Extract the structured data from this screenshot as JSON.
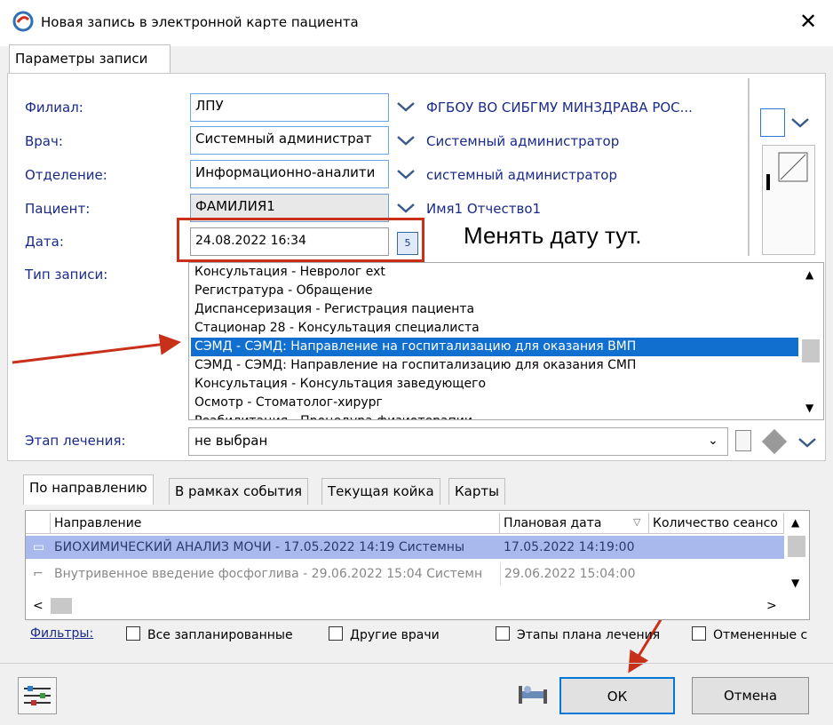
{
  "window": {
    "title": "Новая запись в электронной карте пациента",
    "close_glyph": "✕"
  },
  "tabs_top": {
    "params": "Параметры записи"
  },
  "form": {
    "branch": {
      "label": "Филиал:",
      "value": "ЛПУ",
      "link": "ФГБОУ ВО СИБГМУ МИНЗДРАВА РОС..."
    },
    "doctor": {
      "label": "Врач:",
      "value": "Системный администрат",
      "link": "Системный администратор"
    },
    "department": {
      "label": "Отделение:",
      "value": "Информационно-аналити",
      "link": "системный администратор"
    },
    "patient": {
      "label": "Пациент:",
      "value": "ФАМИЛИЯ1",
      "link": "Имя1 Отчество1"
    },
    "date": {
      "label": "Дата:",
      "value": "24.08.2022 16:34"
    },
    "record_type": {
      "label": "Тип записи:",
      "items": [
        "Консультация - Невролог ext",
        "Регистратура - Обращение",
        "Диспансеризация - Регистрация пациента",
        "Стационар 28 - Консультация специалиста",
        "СЭМД - СЭМД: Направление на госпитализацию для оказания ВМП",
        "СЭМД - СЭМД: Направление на госпитализацию для оказания СМП",
        "Консультация - Консультация заведующего",
        "Осмотр - Стоматолог-хирург",
        "Реабилитация - Процедура физиотерапии"
      ],
      "selected_index": 4
    },
    "stage": {
      "label": "Этап лечения:",
      "value": "не выбран"
    }
  },
  "annotation": {
    "note": "Менять дату тут."
  },
  "bottom_tabs": [
    "По направлению",
    "В рамках события",
    "Текущая койка",
    "Карты"
  ],
  "grid": {
    "columns": [
      "Направление",
      "Плановая дата",
      "Количество сеансо"
    ],
    "rows": [
      {
        "direction": "БИОХИМИЧЕСКИЙ АНАЛИЗ МОЧИ - 17.05.2022 14:19 Системны",
        "date": "17.05.2022 14:19:00",
        "count": "",
        "selected": true
      },
      {
        "direction": "Внутривенное введение фосфоглива - 29.06.2022 15:04 Системн",
        "date": "29.06.2022 15:04:00",
        "count": "",
        "selected": false
      }
    ]
  },
  "filters": {
    "label": "Фильтры:",
    "checks": [
      "Все запланированные",
      "Другие врачи",
      "Этапы плана лечения",
      "Отмененные с"
    ]
  },
  "buttons": {
    "ok": "ОК",
    "cancel": "Отмена"
  },
  "colors": {
    "accent": "#1170cf",
    "selected_row": "#a9b9ee",
    "annotation_red": "#c8301a",
    "label_blue": "#1a2a8a"
  }
}
